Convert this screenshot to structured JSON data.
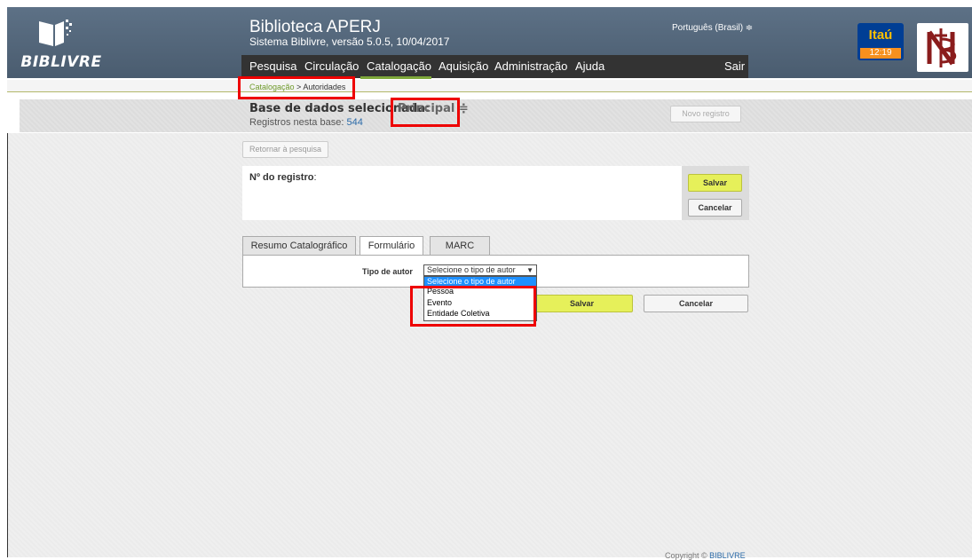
{
  "header": {
    "title": "Biblioteca APERJ",
    "subtitle": "Sistema Biblivre, versão 5.0.5, 10/04/2017",
    "logo_text": "BIBLIVRE",
    "language": "Português (Brasil) ≑"
  },
  "menu": {
    "items": [
      "Pesquisa",
      "Circulação",
      "Catalogação",
      "Aquisição",
      "Administração",
      "Ajuda"
    ],
    "logout": "Sair",
    "active_color": "#7ea83a"
  },
  "tray": {
    "itau_name": "Itaú",
    "itau_time": "12:19"
  },
  "breadcrumb": {
    "link": "Catalogação",
    "separator": " > ",
    "current": "Autoridades"
  },
  "database": {
    "label": "Base de dados selecionada:",
    "value": "Principal ≑",
    "count_label": "Registros nesta base: ",
    "count": "544",
    "new_record": "Novo registro"
  },
  "actions": {
    "back": "Retornar à pesquisa",
    "save": "Salvar",
    "cancel": "Cancelar"
  },
  "record": {
    "label": "Nº do registro",
    "suffix": ":"
  },
  "tabs": [
    "Resumo Catalográfico",
    "Formulário",
    "MARC"
  ],
  "form": {
    "autor_label": "Tipo de autor",
    "select_value": "Selecione o tipo de autor",
    "options": [
      "Selecione o tipo de autor",
      "Pessoa",
      "Evento",
      "Entidade Coletiva"
    ]
  },
  "footer": {
    "text": "Copyright © ",
    "link": "BIBLIVRE"
  },
  "highlight_color": "#e00000"
}
